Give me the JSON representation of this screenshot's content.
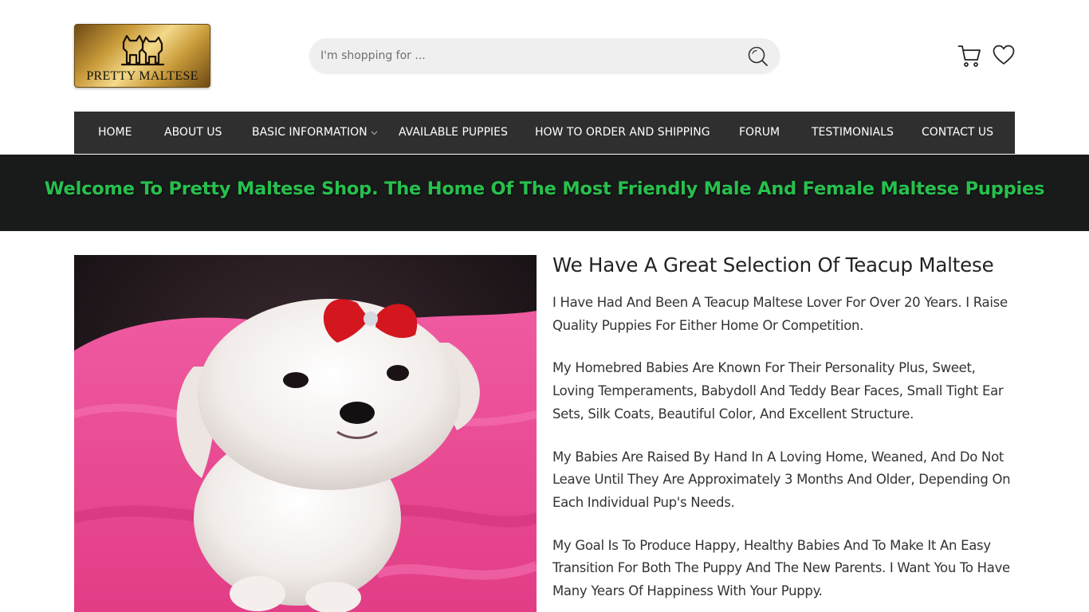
{
  "brand": {
    "logo_text": "PRETTY MALTESE"
  },
  "search": {
    "placeholder": "I'm shopping for ..."
  },
  "icons": {
    "search": "search-icon",
    "cart": "cart-icon",
    "wishlist": "heart-icon"
  },
  "nav": {
    "items": [
      {
        "label": "HOME"
      },
      {
        "label": "ABOUT US"
      },
      {
        "label": "BASIC INFORMATION",
        "has_dropdown": true
      },
      {
        "label": "AVAILABLE PUPPIES"
      },
      {
        "label": "HOW TO ORDER AND SHIPPING"
      },
      {
        "label": "FORUM"
      },
      {
        "label": "TESTIMONIALS"
      },
      {
        "label": "CONTACT US"
      }
    ]
  },
  "banner": {
    "text": "Welcome To Pretty Maltese Shop. The Home Of The Most Friendly Male And Female Maltese Puppies"
  },
  "main": {
    "heading": "We Have A Great Selection Of Teacup Maltese",
    "paragraphs": [
      "I Have Had And Been A Teacup Maltese Lover For Over 20 Years. I Raise Quality Puppies For Either Home Or Competition.",
      "My Homebred Babies Are Known For Their Personality Plus, Sweet, Loving Temperaments, Babydoll And Teddy Bear Faces, Small Tight Ear Sets, Silk Coats, Beautiful Color, And Excellent Structure.",
      "My Babies Are Raised By Hand In A Loving Home, Weaned, And Do Not Leave Until They Are Approximately 3 Months And Older, Depending On Each Individual Pup's Needs.",
      "My Goal Is To Produce Happy, Healthy Babies And To Make It An Easy Transition For Both The Puppy And The New Parents. I Want You To Have Many Years Of Happiness With Your Puppy."
    ]
  },
  "colors": {
    "nav_bg": "#2f2f2f",
    "banner_bg": "#191a1a",
    "banner_text": "#27c04d",
    "blanket_pink": "#e8448e"
  }
}
